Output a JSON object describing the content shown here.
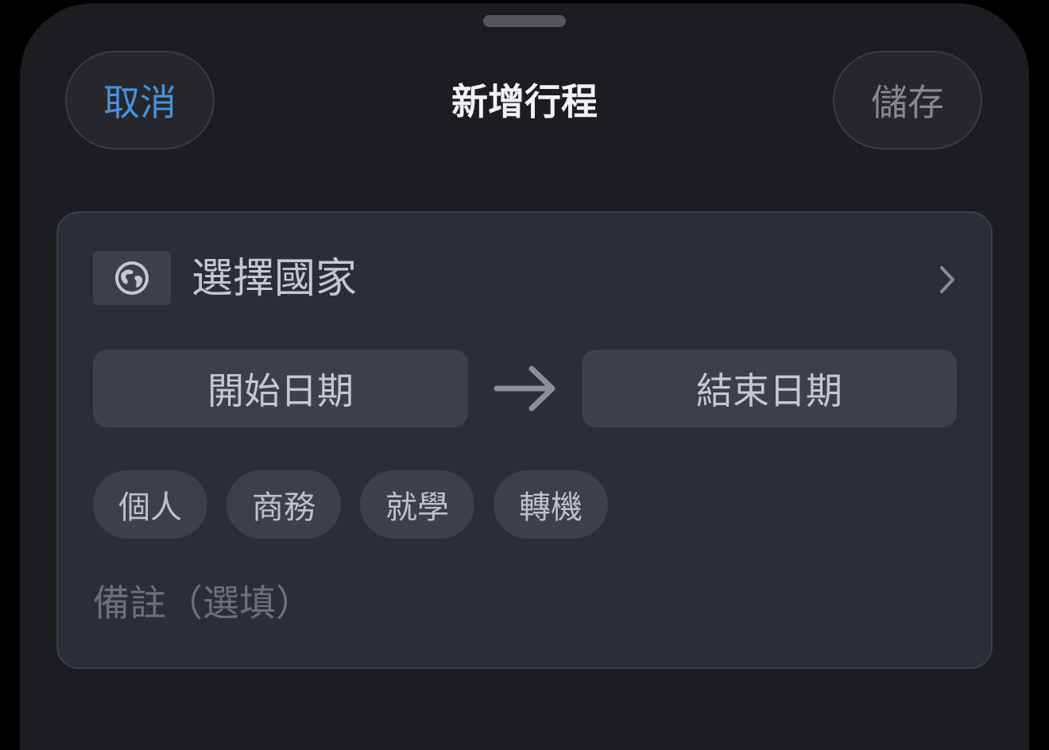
{
  "sheet": {
    "grabber": "sheet-grabber"
  },
  "header": {
    "cancel_label": "取消",
    "title": "新增行程",
    "save_label": "儲存"
  },
  "form": {
    "country": {
      "icon": "globe-icon",
      "label": "選擇國家",
      "chevron_icon": "chevron-right-icon"
    },
    "dates": {
      "start_label": "開始日期",
      "arrow_icon": "arrow-right-icon",
      "end_label": "結束日期"
    },
    "trip_types": [
      {
        "label": "個人"
      },
      {
        "label": "商務"
      },
      {
        "label": "就學"
      },
      {
        "label": "轉機"
      }
    ],
    "notes": {
      "value": "",
      "placeholder": "備註（選填）"
    }
  },
  "colors": {
    "accent": "#4a92d6",
    "background": "#1c1d21",
    "card": "#2a2e36",
    "control": "#3d4049",
    "title_text": "#f2f2f4",
    "disabled_text": "#86888e"
  }
}
